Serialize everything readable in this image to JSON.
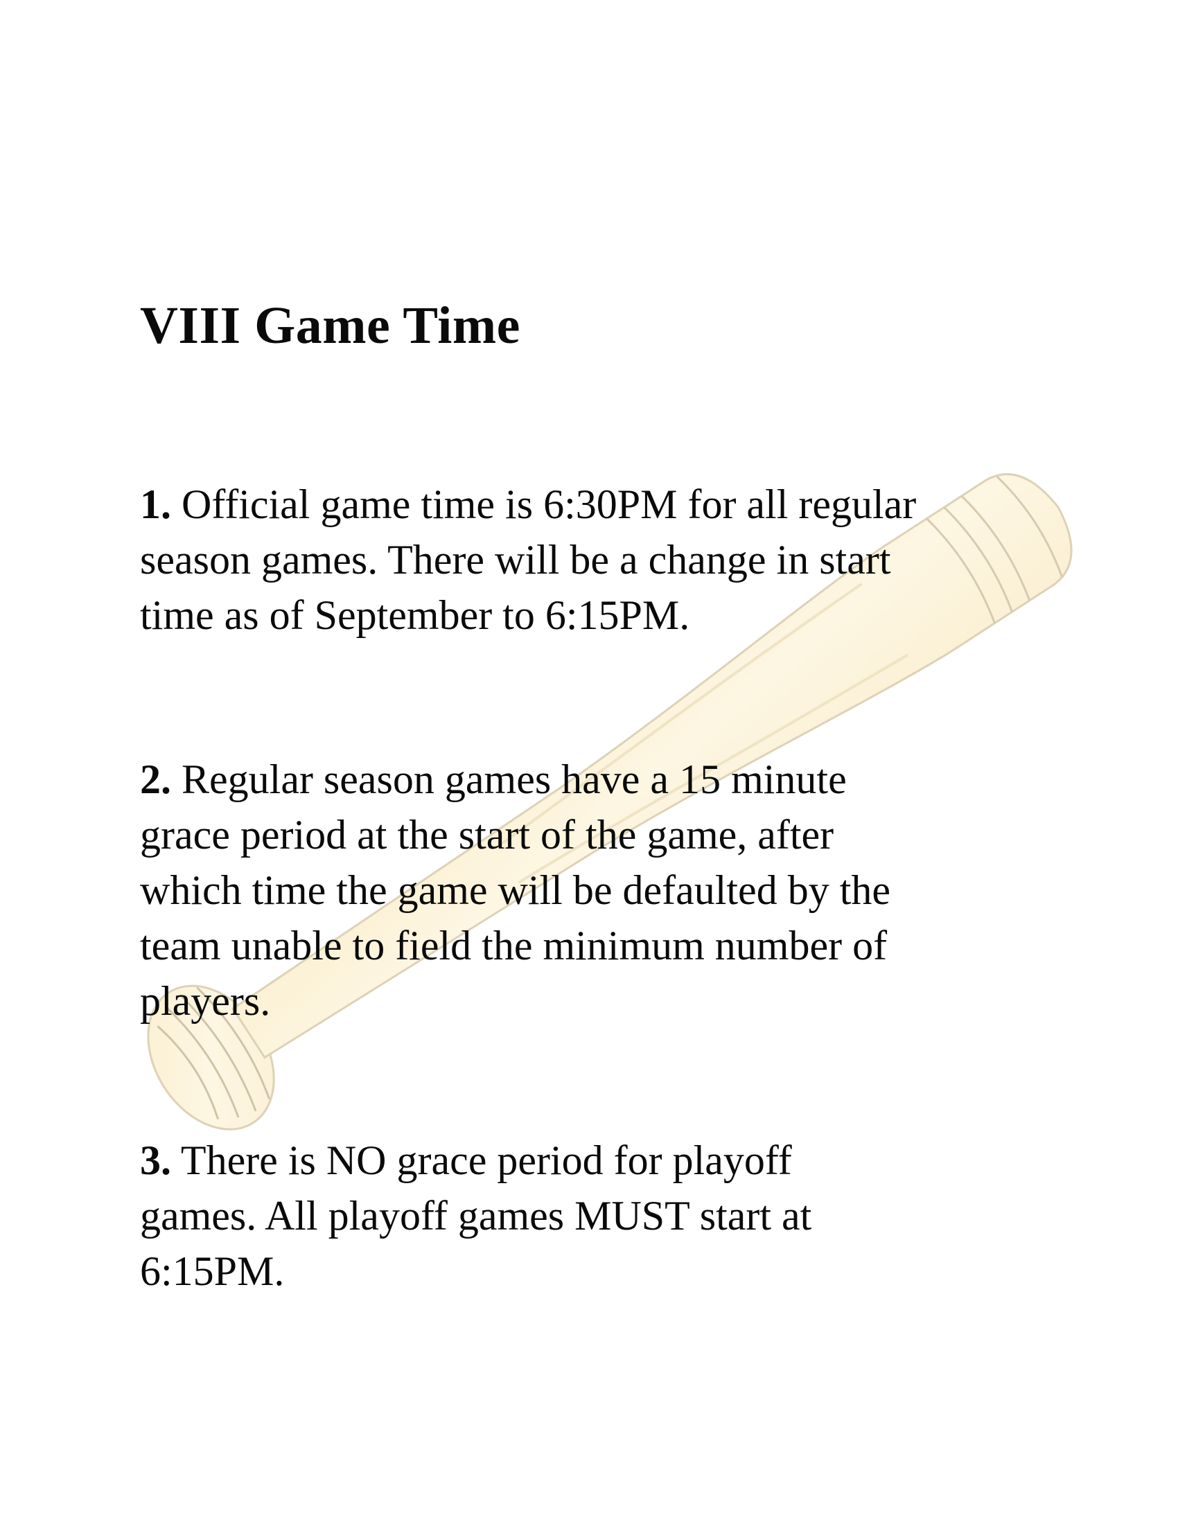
{
  "section": {
    "heading": "VIII Game Time"
  },
  "rules": [
    {
      "number": "1.",
      "lines": [
        "Official game time is 6:30PM for all regular",
        "season games.  There will be a change in start",
        "time as of September to 6:15PM."
      ]
    },
    {
      "number": "2.",
      "lines": [
        "Regular season games have a 15 minute",
        "grace period at the start of the game, after",
        "which time the game will be defaulted by the",
        "team unable to field the minimum number of",
        "players."
      ]
    },
    {
      "number": "3.",
      "lines": [
        "There is NO grace period for playoff",
        "games.  All playoff games MUST start at",
        "6:15PM."
      ]
    }
  ],
  "colors": {
    "text": "#0a0a0a",
    "bat_fill": "#fdf3d8",
    "bat_stroke": "#ddd2b8",
    "background": "#ffffff"
  },
  "icons": {
    "watermark": "baseball-bat-icon"
  }
}
